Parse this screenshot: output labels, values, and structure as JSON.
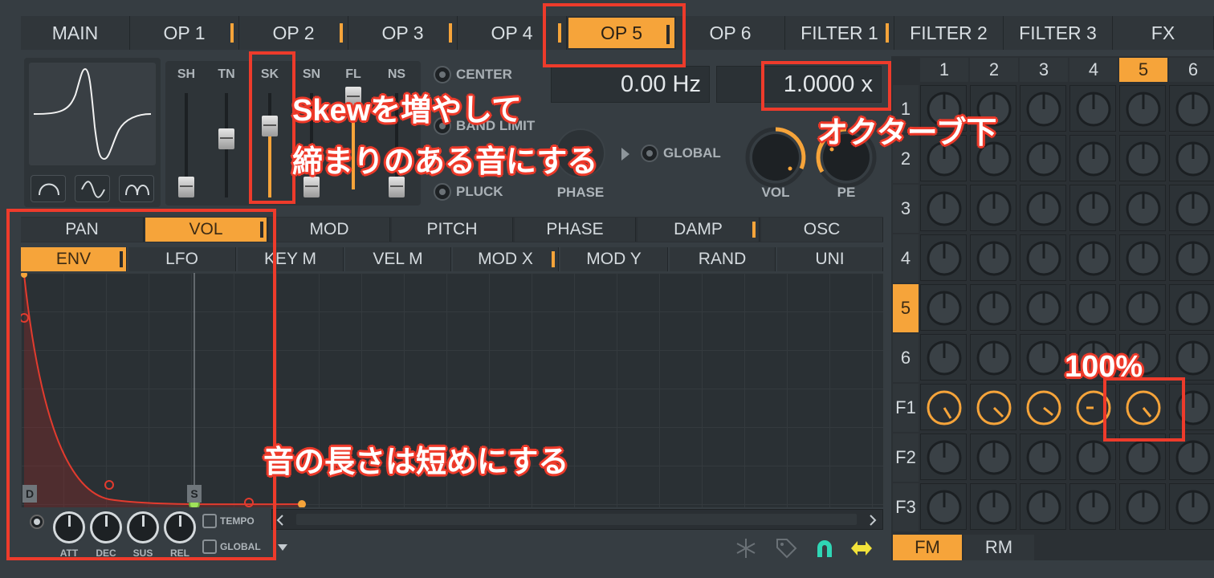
{
  "top_tabs": [
    {
      "label": "MAIN",
      "mark": false,
      "active": false
    },
    {
      "label": "OP 1",
      "mark": true,
      "active": false
    },
    {
      "label": "OP 2",
      "mark": true,
      "active": false
    },
    {
      "label": "OP 3",
      "mark": true,
      "active": false
    },
    {
      "label": "OP 4",
      "mark": true,
      "active": false
    },
    {
      "label": "OP 5",
      "mark": true,
      "active": true
    },
    {
      "label": "OP 6",
      "mark": false,
      "active": false
    },
    {
      "label": "FILTER 1",
      "mark": true,
      "active": false
    },
    {
      "label": "FILTER 2",
      "mark": false,
      "active": false
    },
    {
      "label": "FILTER 3",
      "mark": false,
      "active": false
    },
    {
      "label": "FX",
      "mark": false,
      "active": false
    }
  ],
  "faders": {
    "labels": [
      "SH",
      "TN",
      "SK",
      "SN",
      "FL",
      "NS"
    ]
  },
  "radios": {
    "center": "CENTER",
    "band_limit": "BAND LIMIT",
    "pluck": "PLUCK",
    "global": "GLOBAL"
  },
  "displays": {
    "frequency": "0.00 Hz",
    "ratio": "1.0000 x"
  },
  "knob_labels": {
    "phase": "PHASE",
    "vol": "VOL",
    "pe": "PE"
  },
  "mod_tabs": [
    {
      "label": "PAN",
      "mark": false,
      "active": false
    },
    {
      "label": "VOL",
      "mark": true,
      "active": true
    },
    {
      "label": "MOD",
      "mark": false,
      "active": false
    },
    {
      "label": "PITCH",
      "mark": false,
      "active": false
    },
    {
      "label": "PHASE",
      "mark": false,
      "active": false
    },
    {
      "label": "DAMP",
      "mark": true,
      "active": false
    },
    {
      "label": "OSC",
      "mark": false,
      "active": false
    }
  ],
  "env_tabs": [
    {
      "label": "ENV",
      "mark": true,
      "active": true
    },
    {
      "label": "LFO",
      "mark": false,
      "active": false
    },
    {
      "label": "KEY M",
      "mark": false,
      "active": false
    },
    {
      "label": "VEL M",
      "mark": false,
      "active": false
    },
    {
      "label": "MOD X",
      "mark": true,
      "active": false
    },
    {
      "label": "MOD Y",
      "mark": false,
      "active": false
    },
    {
      "label": "RAND",
      "mark": false,
      "active": false
    },
    {
      "label": "UNI",
      "mark": false,
      "active": false
    }
  ],
  "envelope": {
    "decay_marker": "D",
    "sustain_marker": "S",
    "knobs": [
      "ATT",
      "DEC",
      "SUS",
      "REL"
    ],
    "tempo": "TEMPO",
    "global": "GLOBAL"
  },
  "matrix": {
    "col_headers": [
      "1",
      "2",
      "3",
      "4",
      "5",
      "6"
    ],
    "row_headers": [
      "1",
      "2",
      "3",
      "4",
      "5",
      "6",
      "F1",
      "F2",
      "F3"
    ],
    "active_col": "5",
    "active_row": "5",
    "modes": [
      "FM",
      "RM"
    ]
  },
  "annotations": {
    "skew": "Skewを増やして",
    "tight": "締まりのある音にする",
    "octave": "オクターブ下",
    "percent": "100%",
    "length": "音の長さは短めにする"
  },
  "colors": {
    "accent": "#f6a43a",
    "annotation": "#ee3b2b",
    "background": "#363d42"
  }
}
